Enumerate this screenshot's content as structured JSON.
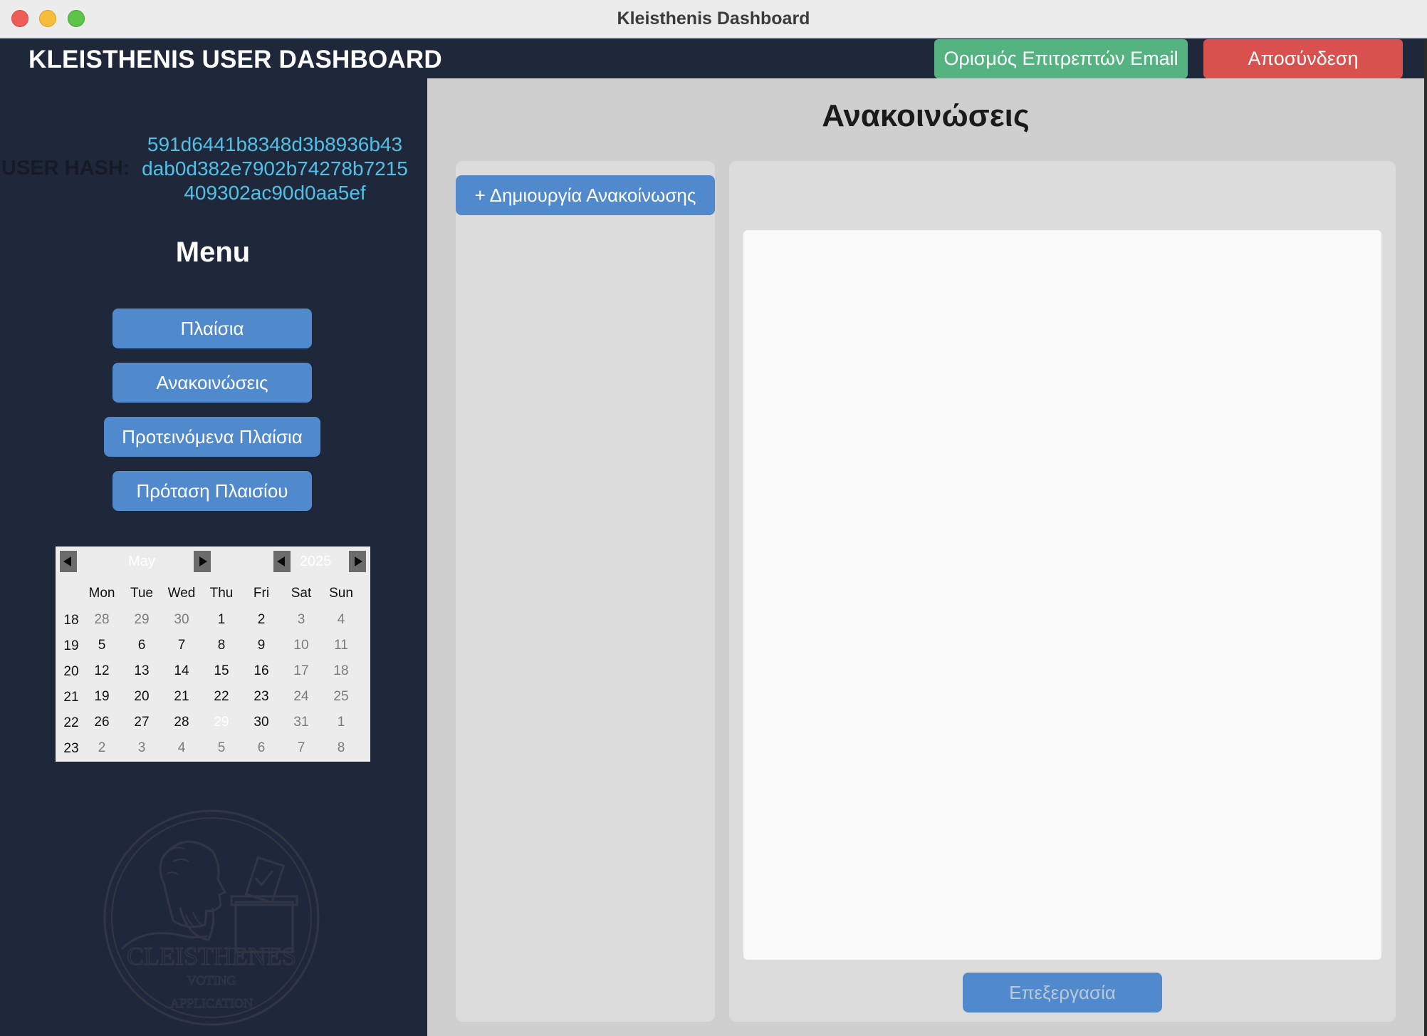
{
  "window": {
    "title": "Kleisthenis Dashboard"
  },
  "header": {
    "title": "KLEISTHENIS USER DASHBOARD",
    "email_button": "Ορισμός Επιτρεπτών Email",
    "logout_button": "Αποσύνδεση"
  },
  "sidebar": {
    "hash_label": "USER HASH:",
    "hash_lines": [
      "591d6441b8348d3b8936b43",
      "dab0d382e7902b74278b7215",
      "409302ac90d0aa5ef"
    ],
    "menu_title": "Menu",
    "menu_items": [
      {
        "label": "Πλαίσια"
      },
      {
        "label": "Ανακοινώσεις"
      },
      {
        "label": "Προτεινόμενα Πλαίσια"
      },
      {
        "label": "Πρόταση Πλαισίου"
      }
    ],
    "logo_text": {
      "main": "CLEISTHENES",
      "sub1": "VOTING",
      "sub2": "APPLICATION"
    }
  },
  "calendar": {
    "month": "May",
    "year": "2025",
    "weekdays": [
      "Mon",
      "Tue",
      "Wed",
      "Thu",
      "Fri",
      "Sat",
      "Sun"
    ],
    "selected_day": "29",
    "weeks": [
      {
        "week": "18",
        "days": [
          [
            "28",
            "other"
          ],
          [
            "29",
            "other"
          ],
          [
            "30",
            "other"
          ],
          [
            "1",
            "cur"
          ],
          [
            "2",
            "cur"
          ],
          [
            "3",
            "other"
          ],
          [
            "4",
            "other"
          ]
        ]
      },
      {
        "week": "19",
        "days": [
          [
            "5",
            "cur"
          ],
          [
            "6",
            "cur"
          ],
          [
            "7",
            "cur"
          ],
          [
            "8",
            "cur"
          ],
          [
            "9",
            "cur"
          ],
          [
            "10",
            "other"
          ],
          [
            "11",
            "other"
          ]
        ]
      },
      {
        "week": "20",
        "days": [
          [
            "12",
            "cur"
          ],
          [
            "13",
            "cur"
          ],
          [
            "14",
            "cur"
          ],
          [
            "15",
            "cur"
          ],
          [
            "16",
            "cur"
          ],
          [
            "17",
            "other"
          ],
          [
            "18",
            "other"
          ]
        ]
      },
      {
        "week": "21",
        "days": [
          [
            "19",
            "cur"
          ],
          [
            "20",
            "cur"
          ],
          [
            "21",
            "cur"
          ],
          [
            "22",
            "cur"
          ],
          [
            "23",
            "cur"
          ],
          [
            "24",
            "other"
          ],
          [
            "25",
            "other"
          ]
        ]
      },
      {
        "week": "22",
        "days": [
          [
            "26",
            "cur"
          ],
          [
            "27",
            "cur"
          ],
          [
            "28",
            "cur"
          ],
          [
            "29",
            "sel"
          ],
          [
            "30",
            "cur"
          ],
          [
            "31",
            "other"
          ],
          [
            "1",
            "other"
          ]
        ]
      },
      {
        "week": "23",
        "days": [
          [
            "2",
            "other"
          ],
          [
            "3",
            "other"
          ],
          [
            "4",
            "other"
          ],
          [
            "5",
            "other"
          ],
          [
            "6",
            "other"
          ],
          [
            "7",
            "other"
          ],
          [
            "8",
            "other"
          ]
        ]
      }
    ]
  },
  "main": {
    "title": "Ανακοινώσεις",
    "create_button": "+ Δημιουργία Ανακοίνωσης",
    "edit_button": "Επεξεργασία",
    "content_value": ""
  },
  "colors": {
    "sidebar_bg": "#1f283a",
    "accent_blue": "#5089cc",
    "green": "#55b381",
    "red": "#d9514e",
    "hash_cyan": "#52c0e6"
  }
}
